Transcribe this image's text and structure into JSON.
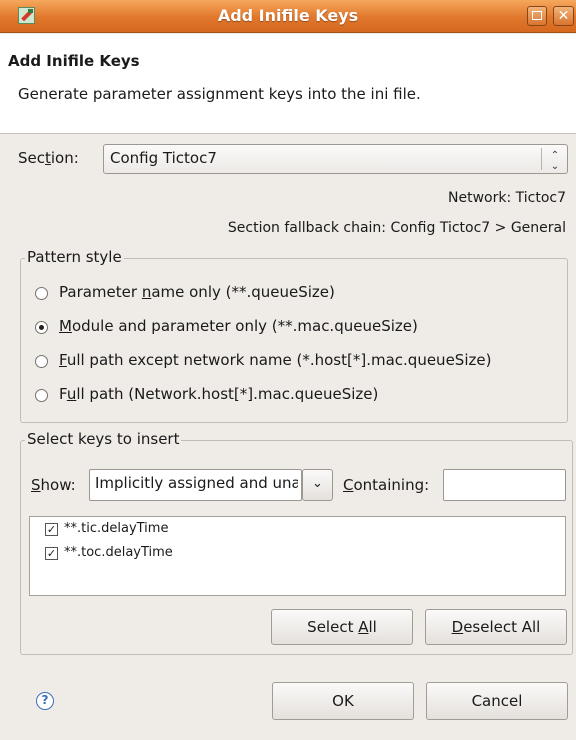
{
  "window": {
    "title": "Add Inifile Keys",
    "maximize_icon": "maximize-icon",
    "close_icon": "close-icon",
    "close_glyph": "✕"
  },
  "header": {
    "title": "Add Inifile Keys",
    "description": "Generate parameter assignment keys into the ini file."
  },
  "section": {
    "label_pre": "Sec",
    "label_mnemonic": "t",
    "label_post": "ion:",
    "value": "Config Tictoc7",
    "arrows_glyph": "⌃⌄"
  },
  "info": {
    "network": "Network: Tictoc7",
    "fallback_chain": "Section fallback chain: Config Tictoc7 > General"
  },
  "pattern_style": {
    "title": "Pattern style",
    "options": [
      {
        "pre": "Parameter ",
        "mn": "n",
        "post": "ame only (**.queueSize)",
        "selected": false
      },
      {
        "pre": "",
        "mn": "M",
        "post": "odule and parameter only (**.mac.queueSize)",
        "selected": true
      },
      {
        "pre": "",
        "mn": "F",
        "post": "ull path except network name (*.host[*].mac.queueSize)",
        "selected": false
      },
      {
        "pre": "F",
        "mn": "u",
        "post": "ll path (Network.host[*].mac.queueSize)",
        "selected": false
      }
    ]
  },
  "select_keys": {
    "title": "Select keys to insert",
    "show_mn": "S",
    "show_post": "how:",
    "show_value": "Implicitly assigned and unassigned",
    "dropdown_glyph": "⌄",
    "containing_mn": "C",
    "containing_post": "ontaining:",
    "containing_value": "",
    "keys": [
      {
        "label": "**.tic.delayTime",
        "checked": true
      },
      {
        "label": "**.toc.delayTime",
        "checked": true
      }
    ],
    "check_glyph": "✓",
    "select_all_pre": "Select ",
    "select_all_mn": "A",
    "select_all_post": "ll",
    "deselect_all_mn": "D",
    "deselect_all_post": "eselect All"
  },
  "footer": {
    "help_glyph": "?",
    "help_icon": "help-icon",
    "ok": "OK",
    "cancel": "Cancel"
  },
  "colors": {
    "titlebar": "#e0772c",
    "dialog_bg": "#efebe7",
    "header_bg": "#ffffff"
  }
}
